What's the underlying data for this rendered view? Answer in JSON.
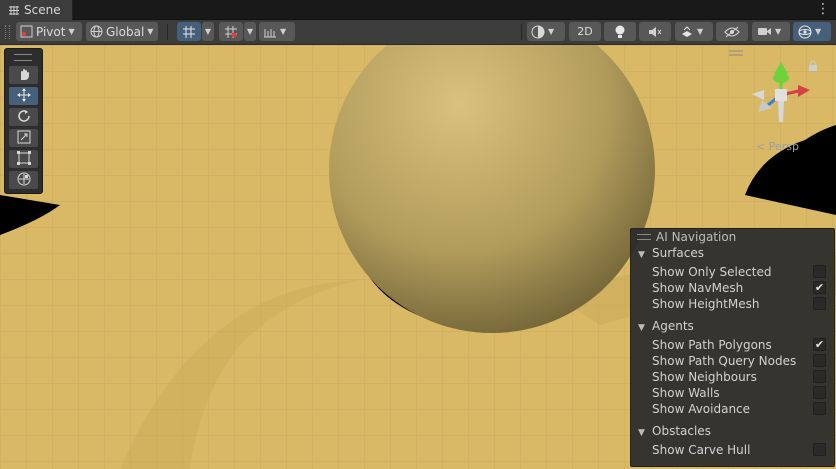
{
  "tab": {
    "title": "Scene",
    "icon": "scene-grid-icon",
    "menu_icon": "kebab-menu-icon"
  },
  "toolbar": {
    "pivot_label": "Pivot",
    "global_label": "Global",
    "mode_2d_label": "2D",
    "icons": [
      "pivot-icon",
      "global-icon",
      "grid-snap-icon",
      "increment-snap-icon",
      "ruler-icon",
      "shading-mode-icon",
      "lighting-icon",
      "audio-mute-icon",
      "effects-icon",
      "visibility-icon",
      "camera-icon",
      "gizmos-icon"
    ]
  },
  "tools": [
    "hand-tool-icon",
    "move-tool-icon",
    "rotate-tool-icon",
    "scale-tool-icon",
    "rect-tool-icon",
    "transform-tool-icon"
  ],
  "active_tool": "move-tool-icon",
  "gizmo": {
    "projection_label": "Persp",
    "colors": {
      "x": "#d64242",
      "y": "#6ed23a",
      "z": "#3d7ed8"
    }
  },
  "ai_navigation": {
    "title": "AI Navigation",
    "sections": [
      {
        "label": "Surfaces",
        "items": [
          {
            "label": "Show Only Selected",
            "checked": false
          },
          {
            "label": "Show NavMesh",
            "checked": true
          },
          {
            "label": "Show HeightMesh",
            "checked": false
          }
        ]
      },
      {
        "label": "Agents",
        "items": [
          {
            "label": "Show Path Polygons",
            "checked": true
          },
          {
            "label": "Show Path Query Nodes",
            "checked": false
          },
          {
            "label": "Show Neighbours",
            "checked": false
          },
          {
            "label": "Show Walls",
            "checked": false
          },
          {
            "label": "Show Avoidance",
            "checked": false
          }
        ]
      },
      {
        "label": "Obstacles",
        "items": [
          {
            "label": "Show Carve Hull",
            "checked": false
          }
        ]
      }
    ]
  },
  "colors": {
    "ground": "#d9b866",
    "sky": "#000000",
    "accent": "#46607c"
  }
}
